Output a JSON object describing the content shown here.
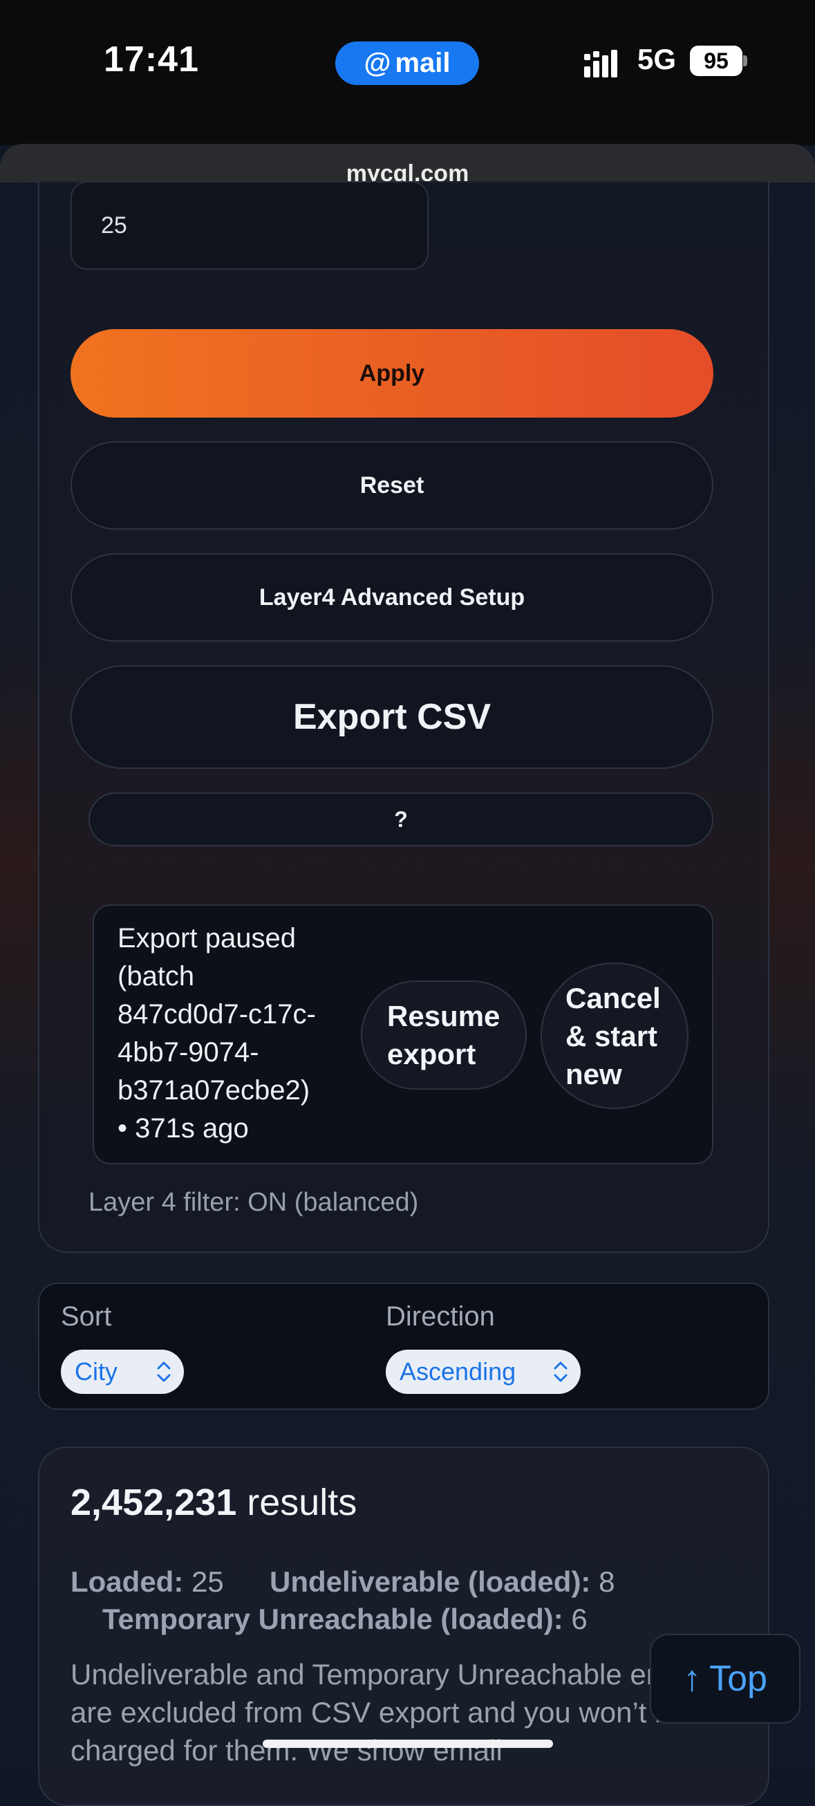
{
  "status_bar": {
    "time": "17:41",
    "app_pill": "mail",
    "app_pill_prefix": "@",
    "network": "5G",
    "battery": "95"
  },
  "browser": {
    "url": "mycql.com"
  },
  "filters": {
    "limit_value": "25",
    "apply_label": "Apply",
    "reset_label": "Reset",
    "advanced_label": "Layer4 Advanced Setup",
    "export_label": "Export CSV",
    "help_label": "?"
  },
  "export_status": {
    "lines": [
      "Export paused",
      "(batch",
      "847cd0d7-c17c-",
      "4bb7-9074-",
      "b371a07ecbe2)",
      "• 371s ago"
    ],
    "resume_lines": [
      "Resume",
      "export"
    ],
    "cancel_lines": [
      "Cancel",
      "& start",
      "new"
    ]
  },
  "layer4_status": "Layer 4 filter: ON (balanced)",
  "sort": {
    "sort_label": "Sort",
    "sort_value": "City",
    "direction_label": "Direction",
    "direction_value": "Ascending"
  },
  "results": {
    "count": "2,452,231",
    "count_suffix": "results",
    "loaded_label": "Loaded:",
    "loaded_value": "25",
    "undeliverable_label": "Undeliverable (loaded):",
    "undeliverable_value": "8",
    "temp_label": "Temporary Unreachable (loaded):",
    "temp_value": "6",
    "note": "Undeliverable and Temporary Unreachable emails are excluded from CSV export and you won’t be charged for them. We show email"
  },
  "top_button": {
    "arrow": "↑",
    "label": "Top"
  }
}
